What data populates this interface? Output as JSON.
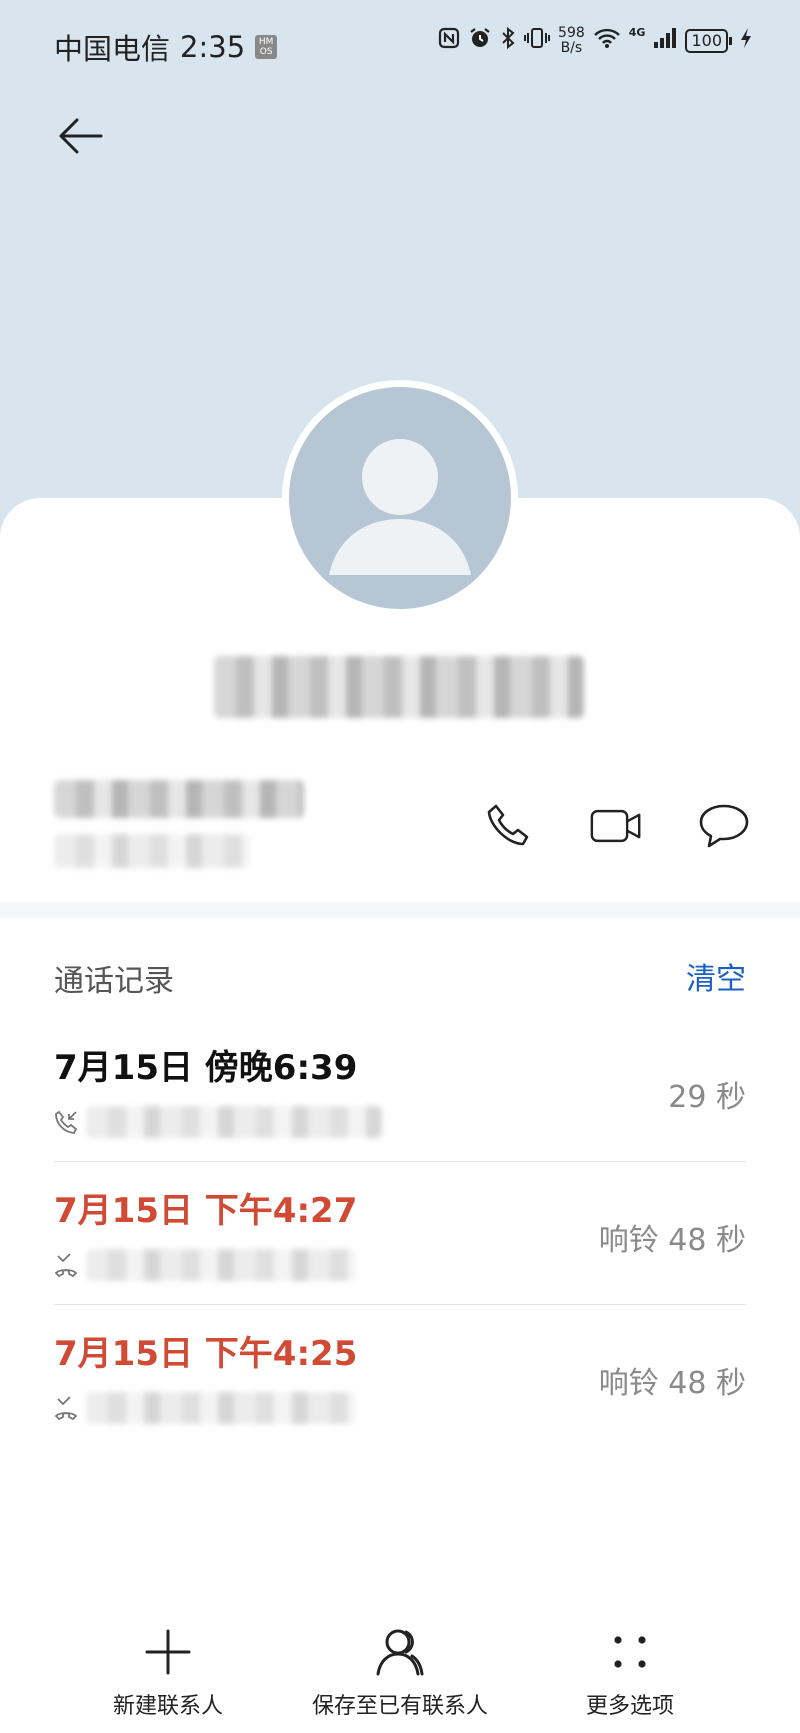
{
  "status_bar": {
    "carrier": "中国电信",
    "time": "2:35",
    "hmos_badge": "HM OS",
    "net_speed_value": "598",
    "net_speed_unit": "B/s",
    "network": "4G",
    "battery": "100"
  },
  "icons": {
    "back": "arrow-left-icon",
    "call": "phone-icon",
    "video": "video-camera-icon",
    "message": "chat-bubble-icon",
    "new_contact": "plus-icon",
    "save_existing": "person-icon",
    "more": "dots-grid-icon"
  },
  "call_log": {
    "title": "通话记录",
    "clear_label": "清空",
    "entries": [
      {
        "time": "7月15日 傍晚6:39",
        "duration": "29 秒",
        "type": "incoming"
      },
      {
        "time": "7月15日 下午4:27",
        "duration": "响铃 48 秒",
        "type": "missed"
      },
      {
        "time": "7月15日 下午4:25",
        "duration": "响铃 48 秒",
        "type": "missed"
      }
    ]
  },
  "bottom_bar": {
    "new_contact": "新建联系人",
    "save_existing": "保存至已有联系人",
    "more": "更多选项"
  },
  "colors": {
    "header_bg": "#d8e4ee",
    "accent_blue": "#1a5fc4",
    "missed_red": "#d04a34",
    "avatar_bg": "#b7c6d4"
  }
}
